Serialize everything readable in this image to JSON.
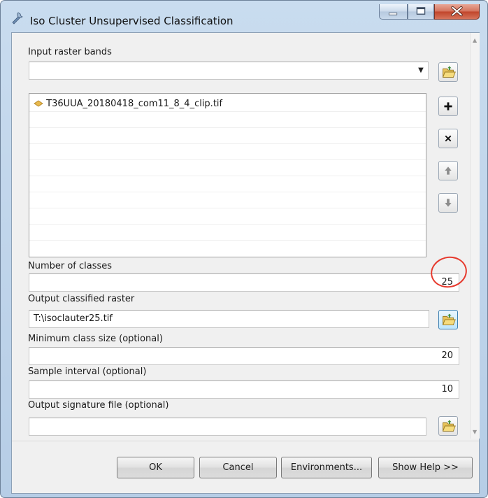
{
  "window": {
    "title": "Iso Cluster Unsupervised Classification",
    "controls": [
      "minimize",
      "maximize",
      "close"
    ]
  },
  "form": {
    "input_raster_bands": {
      "label": "Input raster bands",
      "value": "",
      "items": [
        "T36UUA_20180418_com11_8_4_clip.tif"
      ]
    },
    "number_of_classes": {
      "label": "Number of classes",
      "value": "25"
    },
    "output_classified_raster": {
      "label": "Output classified raster",
      "value": "T:\\isoclauter25.tif"
    },
    "minimum_class_size": {
      "label": "Minimum class size (optional)",
      "value": "20"
    },
    "sample_interval": {
      "label": "Sample interval (optional)",
      "value": "10"
    },
    "output_signature_file": {
      "label": "Output signature file (optional)",
      "value": ""
    }
  },
  "list_tools": [
    "add-icon",
    "remove-icon",
    "move-up-icon",
    "move-down-icon"
  ],
  "buttons": {
    "ok": "OK",
    "cancel": "Cancel",
    "environments": "Environments...",
    "show_help": "Show Help >>"
  },
  "colors": {
    "highlight_circle": "#e63a2e",
    "close_button": "#c0442a",
    "window_frame": "#b6cde6"
  }
}
